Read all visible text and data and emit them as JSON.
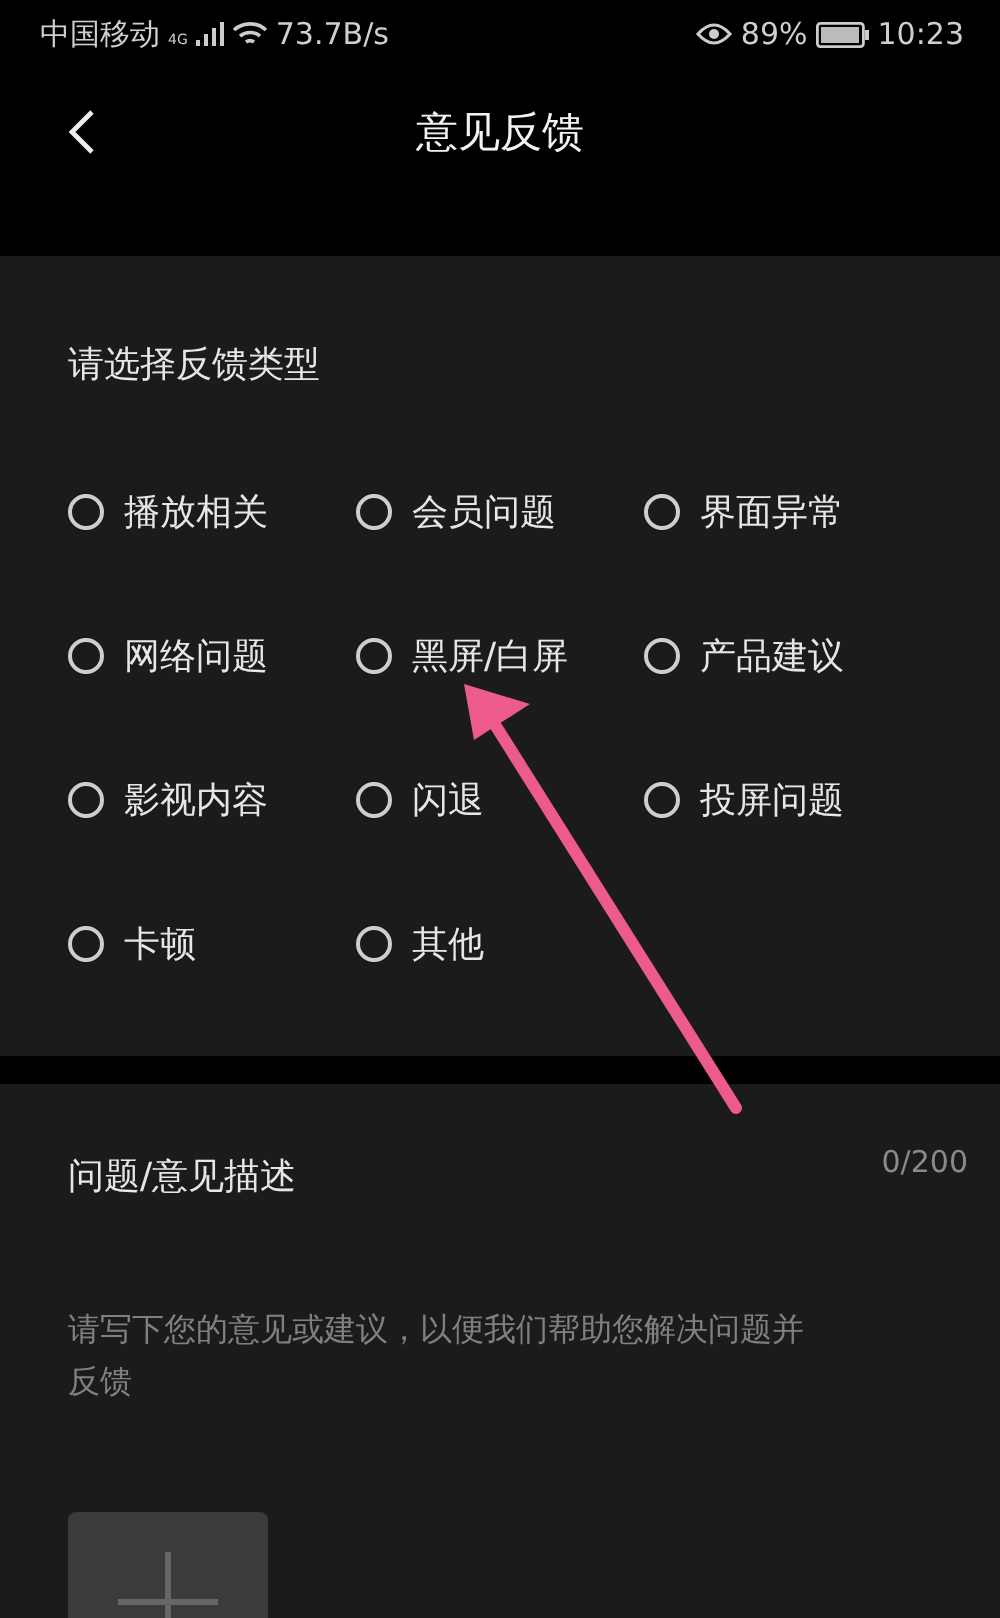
{
  "status_bar": {
    "carrier": "中国移动",
    "network": "4G",
    "speed": "73.7B/s",
    "battery": "89%",
    "time": "10:23"
  },
  "header": {
    "title": "意见反馈"
  },
  "feedback_type": {
    "title": "请选择反馈类型",
    "options": [
      {
        "label": "播放相关",
        "selected": false
      },
      {
        "label": "会员问题",
        "selected": false
      },
      {
        "label": "界面异常",
        "selected": false
      },
      {
        "label": "网络问题",
        "selected": false
      },
      {
        "label": "黑屏/白屏",
        "selected": false
      },
      {
        "label": "产品建议",
        "selected": false
      },
      {
        "label": "影视内容",
        "selected": false
      },
      {
        "label": "闪退",
        "selected": false
      },
      {
        "label": "投屏问题",
        "selected": false
      },
      {
        "label": "卡顿",
        "selected": false
      },
      {
        "label": "其他",
        "selected": false
      }
    ]
  },
  "description": {
    "title": "问题/意见描述",
    "counter": "0/200",
    "placeholder": "请写下您的意见或建议，以便我们帮助您解决问题并反馈"
  }
}
